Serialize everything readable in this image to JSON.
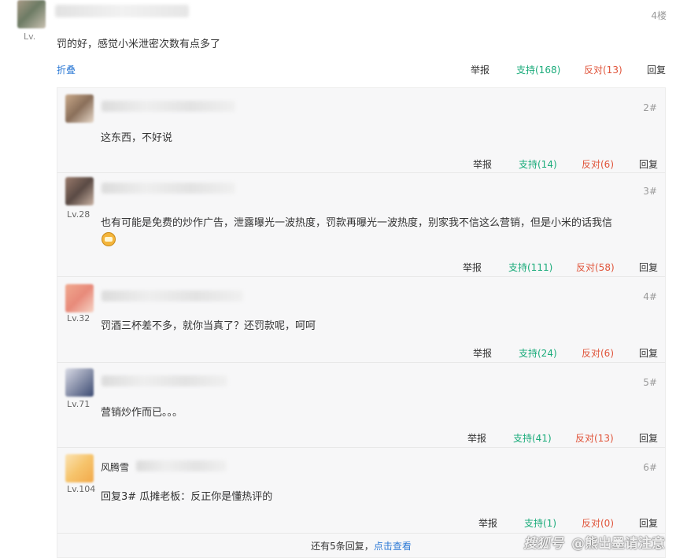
{
  "top_comment": {
    "level": "Lv.",
    "floor": "4楼",
    "text": "罚的好，感觉小米泄密次数有点多了",
    "actions": {
      "fold": "折叠",
      "report": "举报",
      "support": "支持(168)",
      "oppose": "反对(13)",
      "reply": "回复"
    }
  },
  "replies": [
    {
      "name": "",
      "level": "",
      "floor": "2#",
      "text": "这东西，不好说",
      "report": "举报",
      "support": "支持(14)",
      "oppose": "反对(6)",
      "reply": "回复",
      "avatar_colors": [
        "#c9a98a",
        "#8a6f5a",
        "#e7d8c9"
      ]
    },
    {
      "name": "",
      "level": "Lv.28",
      "floor": "3#",
      "text": "也有可能是免费的炒作广告，泄露曝光一波热度，罚款再曝光一波热度，别家我不信这么营销，但是小米的话我信",
      "report": "举报",
      "support": "支持(111)",
      "oppose": "反对(58)",
      "reply": "回复",
      "avatar_colors": [
        "#9a7b6c",
        "#5a4a44",
        "#c9b2a3"
      ]
    },
    {
      "name": "",
      "level": "Lv.32",
      "floor": "4#",
      "text": "罚酒三杯差不多，就你当真了？还罚款呢，呵呵",
      "report": "举报",
      "support": "支持(24)",
      "oppose": "反对(6)",
      "reply": "回复",
      "avatar_colors": [
        "#f0a98f",
        "#e88a7a",
        "#f6d4c6"
      ]
    },
    {
      "name": "",
      "level": "Lv.71",
      "floor": "5#",
      "text": "营销炒作而已。。。",
      "report": "举报",
      "support": "支持(41)",
      "oppose": "反对(13)",
      "reply": "回复",
      "avatar_colors": [
        "#3b4a72",
        "#8a92ab",
        "#d9dbe6"
      ]
    },
    {
      "name": "风腾雪",
      "level": "Lv.104",
      "floor": "6#",
      "text": "回复3# 瓜摊老板：反正你是懂热评的",
      "report": "举报",
      "support": "支持(1)",
      "oppose": "反对(0)",
      "reply": "回复",
      "avatar_colors": [
        "#f6c46c",
        "#f2a94a",
        "#fbe3b3"
      ]
    }
  ],
  "more": {
    "prefix": "还有5条回复，",
    "link": "点击查看"
  },
  "watermark": {
    "brand": "搜狐号",
    "author": "@熊出墨请注意"
  }
}
